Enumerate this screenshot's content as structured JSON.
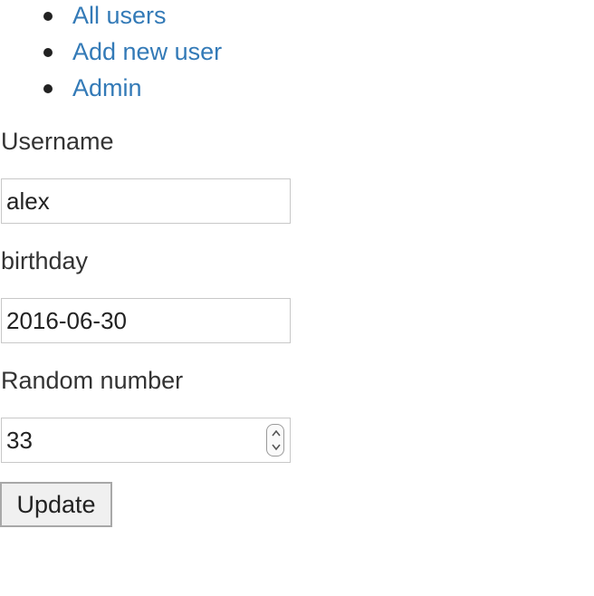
{
  "nav": {
    "items": [
      {
        "label": "All users"
      },
      {
        "label": "Add new user"
      },
      {
        "label": "Admin"
      }
    ]
  },
  "form": {
    "username": {
      "label": "Username",
      "value": "alex"
    },
    "birthday": {
      "label": "birthday",
      "value": "2016-06-30"
    },
    "random_number": {
      "label": "Random number",
      "value": "33"
    },
    "submit_label": "Update"
  },
  "colors": {
    "link": "#337ab7",
    "text": "#333333",
    "input_border": "#c8c8c8",
    "button_bg": "#f0f0f0"
  }
}
